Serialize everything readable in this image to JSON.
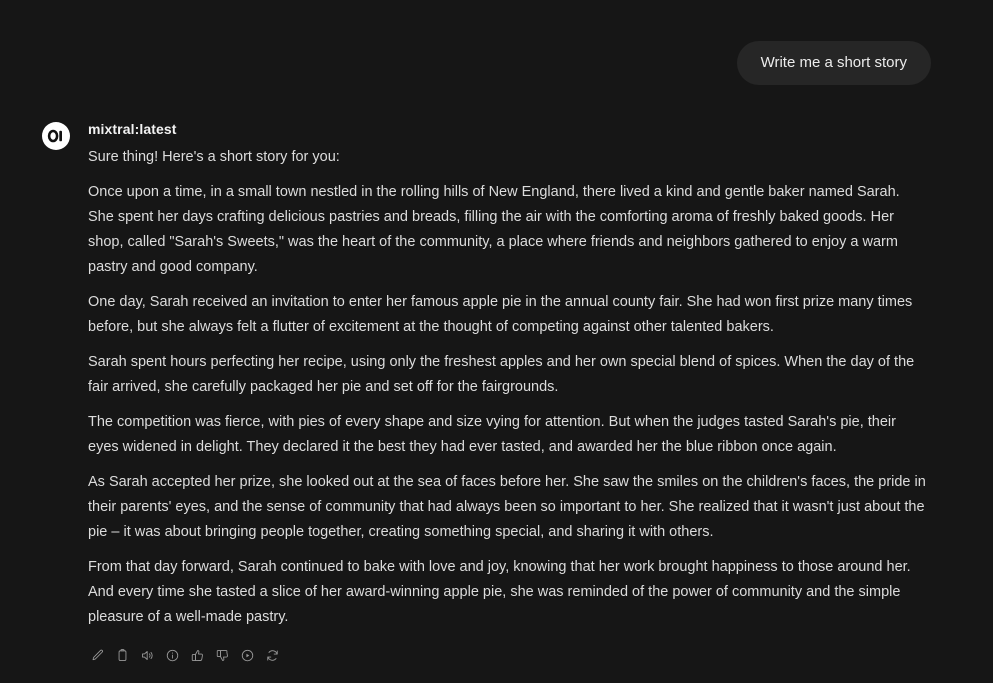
{
  "theme": {
    "background": "#161616",
    "bubble_background": "#262626",
    "body_text": "#dcdcdc",
    "icon_color": "#9a9a9a",
    "avatar_background": "#ffffff"
  },
  "conversation": {
    "user_message": {
      "text": "Write me a short story"
    },
    "assistant_message": {
      "avatar_icon": "oi-logo-icon",
      "model_name": "mixtral:latest",
      "paragraphs": [
        "Sure thing! Here's a short story for you:",
        "Once upon a time, in a small town nestled in the rolling hills of New England, there lived a kind and gentle baker named Sarah. She spent her days crafting delicious pastries and breads, filling the air with the comforting aroma of freshly baked goods. Her shop, called \"Sarah's Sweets,\" was the heart of the community, a place where friends and neighbors gathered to enjoy a warm pastry and good company.",
        "One day, Sarah received an invitation to enter her famous apple pie in the annual county fair. She had won first prize many times before, but she always felt a flutter of excitement at the thought of competing against other talented bakers.",
        "Sarah spent hours perfecting her recipe, using only the freshest apples and her own special blend of spices. When the day of the fair arrived, she carefully packaged her pie and set off for the fairgrounds.",
        "The competition was fierce, with pies of every shape and size vying for attention. But when the judges tasted Sarah's pie, their eyes widened in delight. They declared it the best they had ever tasted, and awarded her the blue ribbon once again.",
        "As Sarah accepted her prize, she looked out at the sea of faces before her. She saw the smiles on the children's faces, the pride in their parents' eyes, and the sense of community that had always been so important to her. She realized that it wasn't just about the pie – it was about bringing people together, creating something special, and sharing it with others.",
        "From that day forward, Sarah continued to bake with love and joy, knowing that her work brought happiness to those around her. And every time she tasted a slice of her award-winning apple pie, she was reminded of the power of community and the simple pleasure of a well-made pastry."
      ],
      "actions": [
        {
          "icon": "pencil-icon",
          "label": "Edit"
        },
        {
          "icon": "clipboard-icon",
          "label": "Copy"
        },
        {
          "icon": "speaker-icon",
          "label": "Read Aloud"
        },
        {
          "icon": "info-icon",
          "label": "Generation Info"
        },
        {
          "icon": "thumbs-up-icon",
          "label": "Good Response"
        },
        {
          "icon": "thumbs-down-icon",
          "label": "Bad Response"
        },
        {
          "icon": "play-circle-icon",
          "label": "Continue Response"
        },
        {
          "icon": "refresh-icon",
          "label": "Regenerate"
        }
      ]
    }
  }
}
